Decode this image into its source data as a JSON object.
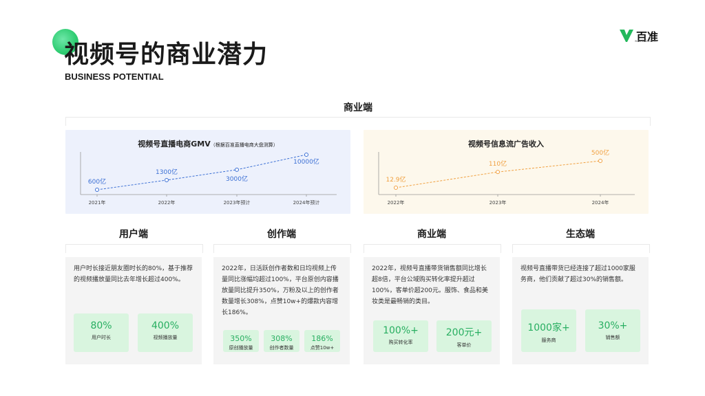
{
  "header": {
    "title": "视频号的商业潜力",
    "subtitle": "BUSINESS POTENTIAL",
    "logo_text": "百准",
    "logo_url": "www.baizhun.cn"
  },
  "top_section": {
    "label": "商业端"
  },
  "charts": {
    "gmv": {
      "title": "视频号直播电商GMV",
      "note": "（根据百准直播电商大盘测算）",
      "x_labels": [
        "2021年",
        "2022年",
        "2023年预计",
        "2024年预计"
      ],
      "value_labels": [
        "600亿",
        "1300亿",
        "3000亿",
        "10000亿"
      ]
    },
    "ads": {
      "title": "视频号信息流广告收入",
      "x_labels": [
        "2022年",
        "2023年",
        "2024年"
      ],
      "value_labels": [
        "12.9亿",
        "110亿",
        "500亿"
      ]
    }
  },
  "chart_data": [
    {
      "type": "line",
      "title": "视频号直播电商GMV",
      "categories": [
        "2021年",
        "2022年",
        "2023年预计",
        "2024年预计"
      ],
      "values": [
        600,
        1300,
        3000,
        10000
      ],
      "color": "#3b6fd4"
    },
    {
      "type": "line",
      "title": "视频号信息流广告收入",
      "categories": [
        "2022年",
        "2023年",
        "2024年"
      ],
      "values": [
        12.9,
        110,
        500
      ],
      "color": "#f0a040"
    }
  ],
  "cards": [
    {
      "heading": "用户端",
      "text": "用户时长接近朋友圈时长的80%，基于推荐的视频播放量同比去年增长超过400%。",
      "stats": [
        {
          "value": "80%",
          "label": "用户时长"
        },
        {
          "value": "400%",
          "label": "视频播放量"
        }
      ]
    },
    {
      "heading": "创作端",
      "text": "2022年，日活跃创作者数和日均视频上传量同比涨幅均超过100%，平台原创内容播放量同比提升350%，万粉及以上的创作者数量增长308%，点赞10w+的爆款内容增长186%。",
      "stats": [
        {
          "value": "350%",
          "label": "原创播放量"
        },
        {
          "value": "308%",
          "label": "创作者数量"
        },
        {
          "value": "186%",
          "label": "点赞10w+"
        }
      ]
    },
    {
      "heading": "商业端",
      "text": "2022年，视频号直播带货销售额同比增长超8倍，平台公域购买转化率提升超过100%，客单价超200元。服饰、食品和美妆类是最畅销的类目。",
      "stats": [
        {
          "value": "100%+",
          "label": "购买转化率"
        },
        {
          "value": "200元+",
          "label": "客单价"
        }
      ]
    },
    {
      "heading": "生态端",
      "text": "视频号直播带货已经连接了超过1000家服务商，他们贡献了超过30%的销售额。",
      "stats": [
        {
          "value": "1000家+",
          "label": "服务商"
        },
        {
          "value": "30%+",
          "label": "销售额"
        }
      ]
    }
  ],
  "colors": {
    "accent": "#2ecc71",
    "stat_bg": "#d9f5df",
    "gmv_bg": "#edf1fc",
    "ads_bg": "#fdf8ec"
  }
}
